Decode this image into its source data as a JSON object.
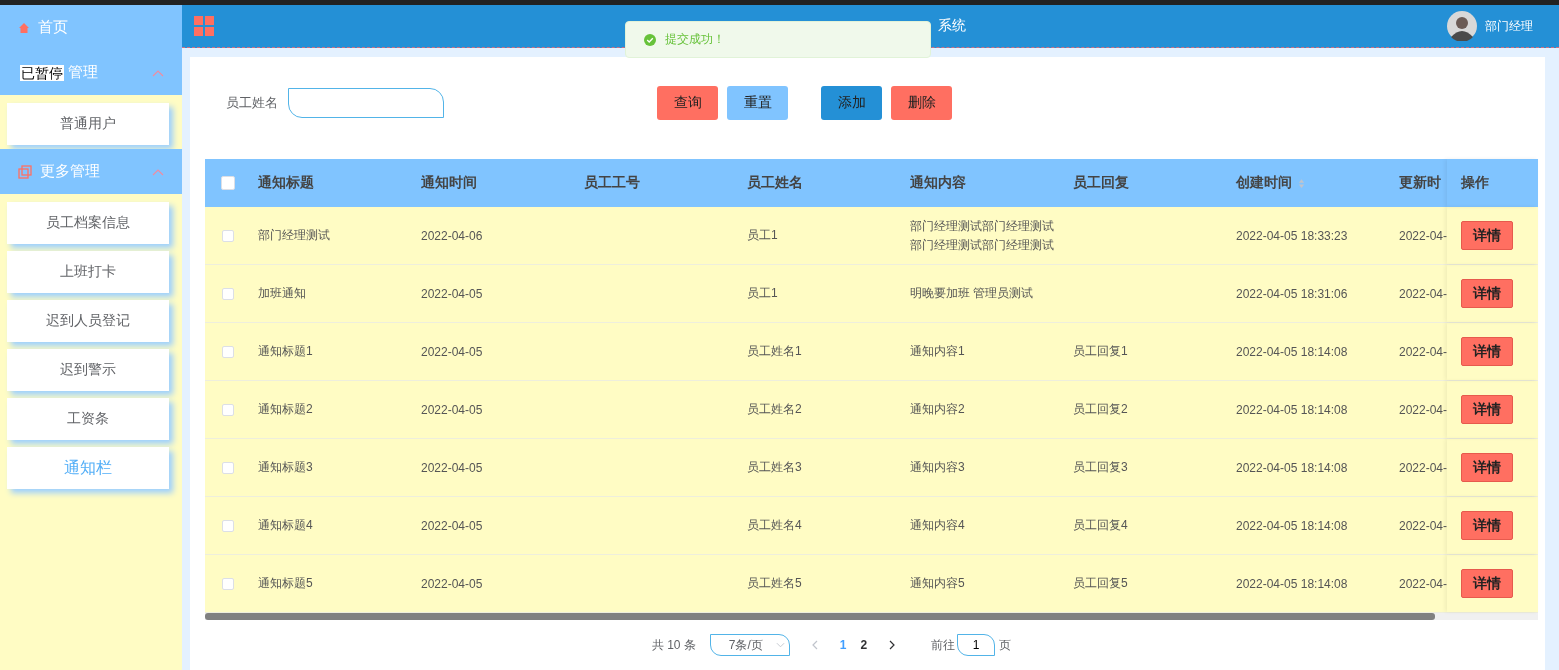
{
  "sidebar": {
    "home": {
      "label": "首页"
    },
    "groups": [
      {
        "title": "管理",
        "overlay": "已暂停",
        "expanded": true,
        "items": [
          {
            "label": "普通用户",
            "selected": false
          }
        ]
      },
      {
        "title": "更多管理",
        "expanded": true,
        "items": [
          {
            "label": "员工档案信息",
            "selected": false
          },
          {
            "label": "上班打卡",
            "selected": false
          },
          {
            "label": "迟到人员登记",
            "selected": false
          },
          {
            "label": "迟到警示",
            "selected": false
          },
          {
            "label": "工资条",
            "selected": false
          },
          {
            "label": "通知栏",
            "selected": true
          }
        ]
      }
    ]
  },
  "header": {
    "title": "系统",
    "user": "部门经理"
  },
  "toast": {
    "message": "提交成功！"
  },
  "search": {
    "label": "员工姓名"
  },
  "buttons": [
    {
      "label": "查询",
      "kind": "danger"
    },
    {
      "label": "重置",
      "kind": "light"
    },
    {
      "label": "添加",
      "kind": "primary"
    },
    {
      "label": "删除",
      "kind": "danger"
    }
  ],
  "table": {
    "columns": [
      "通知标题",
      "通知时间",
      "员工工号",
      "员工姓名",
      "通知内容",
      "员工回复",
      "创建时间",
      "更新时"
    ],
    "action_column": "操作",
    "all_checked": false,
    "rows": [
      {
        "checked": false,
        "cells": [
          "部门经理测试",
          "2022-04-06",
          "",
          "员工1",
          "部门经理测试部门经理测试部门经理测试部门经理测试",
          "",
          "2022-04-05 18:33:23",
          "2022-04-"
        ],
        "action": "详情"
      },
      {
        "checked": false,
        "cells": [
          "加班通知",
          "2022-04-05",
          "",
          "员工1",
          "明晚要加班 管理员测试",
          "",
          "2022-04-05 18:31:06",
          "2022-04-"
        ],
        "action": "详情"
      },
      {
        "checked": false,
        "cells": [
          "通知标题1",
          "2022-04-05",
          "",
          "员工姓名1",
          "通知内容1",
          "员工回复1",
          "2022-04-05 18:14:08",
          "2022-04-"
        ],
        "action": "详情"
      },
      {
        "checked": false,
        "cells": [
          "通知标题2",
          "2022-04-05",
          "",
          "员工姓名2",
          "通知内容2",
          "员工回复2",
          "2022-04-05 18:14:08",
          "2022-04-"
        ],
        "action": "详情"
      },
      {
        "checked": false,
        "cells": [
          "通知标题3",
          "2022-04-05",
          "",
          "员工姓名3",
          "通知内容3",
          "员工回复3",
          "2022-04-05 18:14:08",
          "2022-04-"
        ],
        "action": "详情"
      },
      {
        "checked": false,
        "cells": [
          "通知标题4",
          "2022-04-05",
          "",
          "员工姓名4",
          "通知内容4",
          "员工回复4",
          "2022-04-05 18:14:08",
          "2022-04-"
        ],
        "action": "详情"
      },
      {
        "checked": false,
        "cells": [
          "通知标题5",
          "2022-04-05",
          "",
          "员工姓名5",
          "通知内容5",
          "员工回复5",
          "2022-04-05 18:14:08",
          "2022-04-"
        ],
        "action": "详情"
      }
    ]
  },
  "pagination": {
    "total": "共 10 条",
    "page_size": "7条/页",
    "pages": [
      {
        "label": "1",
        "selected": true
      },
      {
        "label": "2",
        "selected": false
      }
    ],
    "goto_label": "前往",
    "goto_value": "1",
    "goto_suffix": "页"
  }
}
